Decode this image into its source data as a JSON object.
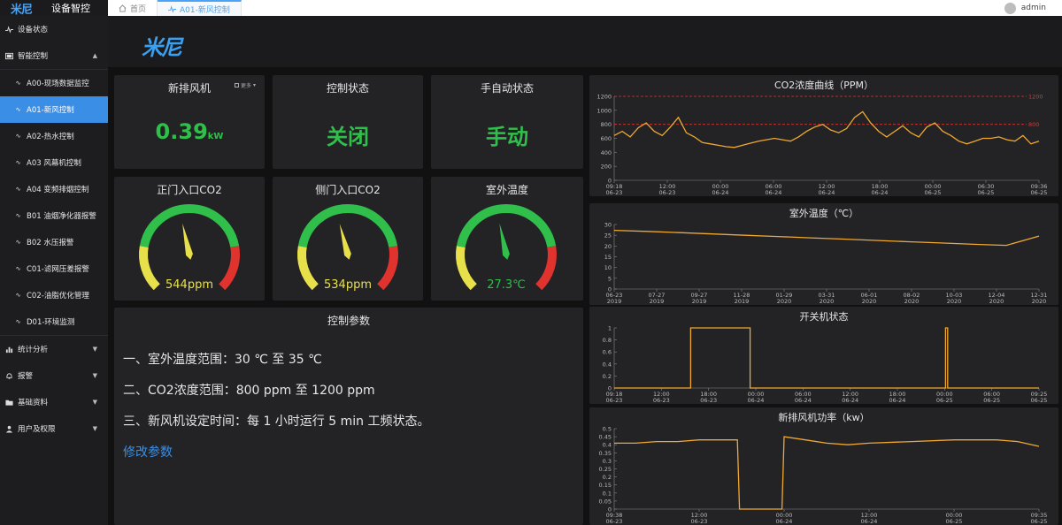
{
  "topbar": {
    "logo": "米尼",
    "system_title": "设备智控",
    "tabs": [
      {
        "label": "首页",
        "icon": "home-icon"
      },
      {
        "label": "A01-新风控制",
        "icon": "pulse-icon"
      }
    ],
    "user": "admin"
  },
  "sidebar": {
    "items": [
      {
        "label": "设备状态",
        "icon": "pulse-icon"
      },
      {
        "label": "智能控制",
        "icon": "dashboard-icon",
        "expanded": true,
        "children": [
          {
            "label": "A00-现场数据监控"
          },
          {
            "label": "A01-新风控制",
            "active": true
          },
          {
            "label": "A02-热水控制"
          },
          {
            "label": "A03 风幕机控制"
          },
          {
            "label": "A04 变频排烟控制"
          },
          {
            "label": "B01 油烟净化器报警"
          },
          {
            "label": "B02 水压报警"
          },
          {
            "label": "C01-滤网压差报警"
          },
          {
            "label": "C02-油脂优化管理"
          },
          {
            "label": "D01-环境监测"
          }
        ]
      },
      {
        "label": "统计分析",
        "icon": "chart-icon"
      },
      {
        "label": "报警",
        "icon": "bell-icon"
      },
      {
        "label": "基础资料",
        "icon": "folder-icon"
      },
      {
        "label": "用户及权限",
        "icon": "user-icon"
      }
    ]
  },
  "main": {
    "logo": "米尼",
    "kpis": [
      {
        "title": "新排风机",
        "value": "0.39",
        "unit": "kW",
        "more": "更多"
      },
      {
        "title": "控制状态",
        "value": "关闭"
      },
      {
        "title": "手自动状态",
        "value": "手动"
      }
    ],
    "gauges": [
      {
        "title": "正门入口CO2",
        "value": 544,
        "unit": "ppm",
        "label": "544ppm",
        "min": 0,
        "max": 1200
      },
      {
        "title": "侧门入口CO2",
        "value": 534,
        "unit": "ppm",
        "label": "534ppm",
        "min": 0,
        "max": 1200
      },
      {
        "title": "室外温度",
        "value": 27.3,
        "unit": "℃",
        "label": "27.3℃",
        "min": 0,
        "max": 60
      }
    ],
    "params": {
      "title": "控制参数",
      "lines": [
        "一、室外温度范围：30 ℃ 至 35 ℃",
        "二、CO2浓度范围：800 ppm 至 1200 ppm",
        "三、新风机设定时间：每 1 小时运行 5 min 工频状态。"
      ],
      "link": "修改参数"
    },
    "colors": {
      "green": "#2fbf4a",
      "accent": "#3a8ee6",
      "line": "#f0a830",
      "red": "#e0332e",
      "yellow": "#e8e04a"
    }
  },
  "chart_data": [
    {
      "type": "line",
      "title": "CO2浓度曲线（PPM）",
      "ylim": [
        0,
        1200
      ],
      "yticks": [
        0,
        200,
        400,
        600,
        800,
        1000,
        1200
      ],
      "xticks": [
        "09:18\n06-23",
        "12:00\n06-23",
        "00:00\n06-24",
        "06:00\n06-24",
        "12:00\n06-24",
        "18:00\n06-24",
        "00:00\n06-25",
        "06:30\n06-25",
        "09:36\n06-25"
      ],
      "markLines": [
        {
          "value": 1200,
          "label": "1200"
        },
        {
          "value": 800,
          "label": "800"
        }
      ],
      "series": [
        {
          "values": [
            640,
            700,
            620,
            750,
            820,
            700,
            640,
            760,
            900,
            680,
            620,
            540,
            520,
            500,
            480,
            470,
            500,
            530,
            560,
            580,
            600,
            580,
            560,
            620,
            700,
            760,
            800,
            720,
            680,
            740,
            900,
            980,
            820,
            700,
            620,
            700,
            780,
            680,
            620,
            760,
            820,
            700,
            640,
            560,
            520,
            560,
            600,
            600,
            620,
            580,
            560,
            640,
            520,
            560
          ]
        }
      ]
    },
    {
      "type": "line",
      "title": "室外温度（℃）",
      "ylim": [
        0,
        30
      ],
      "yticks": [
        0,
        5,
        10,
        15,
        20,
        25,
        30
      ],
      "xticks": [
        "06-23\n2019",
        "07-27\n2019",
        "09-27\n2019",
        "11-28\n2019",
        "01-29\n2020",
        "03-31\n2020",
        "06-01\n2020",
        "08-02\n2020",
        "10-03\n2020",
        "12-04\n2020",
        "12-31\n2020"
      ],
      "series": [
        {
          "values": [
            27.3,
            26.8,
            26.2,
            25.6,
            25.0,
            24.4,
            23.8,
            23.2,
            22.6,
            22.0,
            21.4,
            20.8,
            20.3,
            24.6
          ]
        }
      ]
    },
    {
      "type": "line",
      "title": "开关机状态",
      "ylim": [
        0,
        1
      ],
      "yticks": [
        0,
        0.2,
        0.4,
        0.6,
        0.8,
        1
      ],
      "xticks": [
        "09:18\n06-23",
        "12:00\n06-23",
        "18:00\n06-23",
        "00:00\n06-24",
        "06:00\n06-24",
        "12:00\n06-24",
        "18:00\n06-24",
        "00:00\n06-25",
        "06:00\n06-25",
        "09:25\n06-25"
      ],
      "series": [
        {
          "x": [
            0,
            0.18,
            0.18,
            0.32,
            0.32,
            0.78,
            0.78,
            0.785,
            0.785,
            1
          ],
          "values": [
            0,
            0,
            1,
            1,
            0,
            0,
            1,
            1,
            0,
            0
          ]
        }
      ]
    },
    {
      "type": "line",
      "title": "新排风机功率（kw）",
      "ylim": [
        0,
        0.5
      ],
      "yticks": [
        0,
        0.05,
        0.1,
        0.15,
        0.2,
        0.25,
        0.3,
        0.35,
        0.4,
        0.45,
        0.5
      ],
      "xticks": [
        "09:38\n06-23",
        "12:00\n06-23",
        "00:00\n06-24",
        "12:00\n06-24",
        "00:00\n06-25",
        "09:35\n06-25"
      ],
      "series": [
        {
          "x": [
            0,
            0.05,
            0.1,
            0.15,
            0.2,
            0.29,
            0.295,
            0.395,
            0.4,
            0.45,
            0.5,
            0.55,
            0.6,
            0.7,
            0.8,
            0.9,
            0.95,
            1
          ],
          "values": [
            0.41,
            0.41,
            0.42,
            0.42,
            0.43,
            0.43,
            0,
            0,
            0.45,
            0.43,
            0.41,
            0.4,
            0.41,
            0.42,
            0.43,
            0.43,
            0.42,
            0.39
          ]
        }
      ]
    }
  ]
}
